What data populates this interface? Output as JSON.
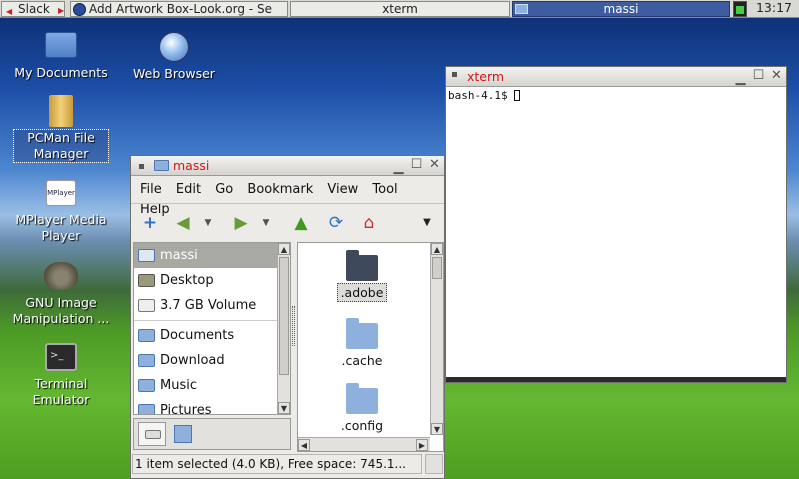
{
  "panel": {
    "slack_label": "Slack",
    "task1_label": "Add  Artwork Box-Look.org - Se",
    "task2_label": "xterm",
    "task3_label": "massi",
    "clock": "13:17"
  },
  "desktop": {
    "icons": [
      {
        "label": "My Documents",
        "icon": "home-folder-icon"
      },
      {
        "label": "Web Browser",
        "icon": "globe-icon"
      },
      {
        "label": "PCMan File Manager",
        "icon": "file-cabinet-icon"
      },
      {
        "label": "MPlayer Media Player",
        "icon": "mplayer-icon"
      },
      {
        "label": "GNU Image Manipulation ...",
        "icon": "gimp-icon"
      },
      {
        "label": "Terminal Emulator",
        "icon": "terminal-icon"
      }
    ]
  },
  "xterm": {
    "title": "xterm",
    "prompt": "bash-4.1$ "
  },
  "filemanager": {
    "title": "massi",
    "menu": [
      "File",
      "Edit",
      "Go",
      "Bookmark",
      "View",
      "Tool",
      "Help"
    ],
    "toolbar_icons": [
      "new-tab-icon",
      "back-icon",
      "forward-icon",
      "up-icon",
      "reload-icon",
      "home-icon"
    ],
    "places": [
      "massi",
      "Desktop",
      "3.7 GB Volume"
    ],
    "bookmarks": [
      "Documents",
      "Download",
      "Music",
      "Pictures"
    ],
    "files": [
      ".adobe",
      ".cache",
      ".config"
    ],
    "status": "1 item selected (4.0 KB), Free space: 745.1..."
  },
  "colors": {
    "title_accent": "#d01818",
    "selection": "#a9a9a4"
  }
}
